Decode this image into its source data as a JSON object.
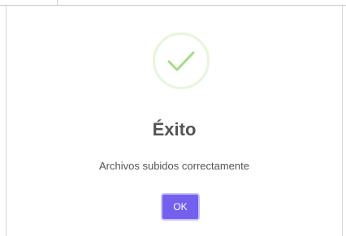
{
  "dialog": {
    "icon": "check-icon",
    "title": "Éxito",
    "message": "Archivos subidos correctamente",
    "ok_label": "OK"
  },
  "colors": {
    "success_green": "#a5dc86",
    "success_ring": "#e6f5dc",
    "button_purple": "#7460ee",
    "text_gray": "#545454"
  }
}
